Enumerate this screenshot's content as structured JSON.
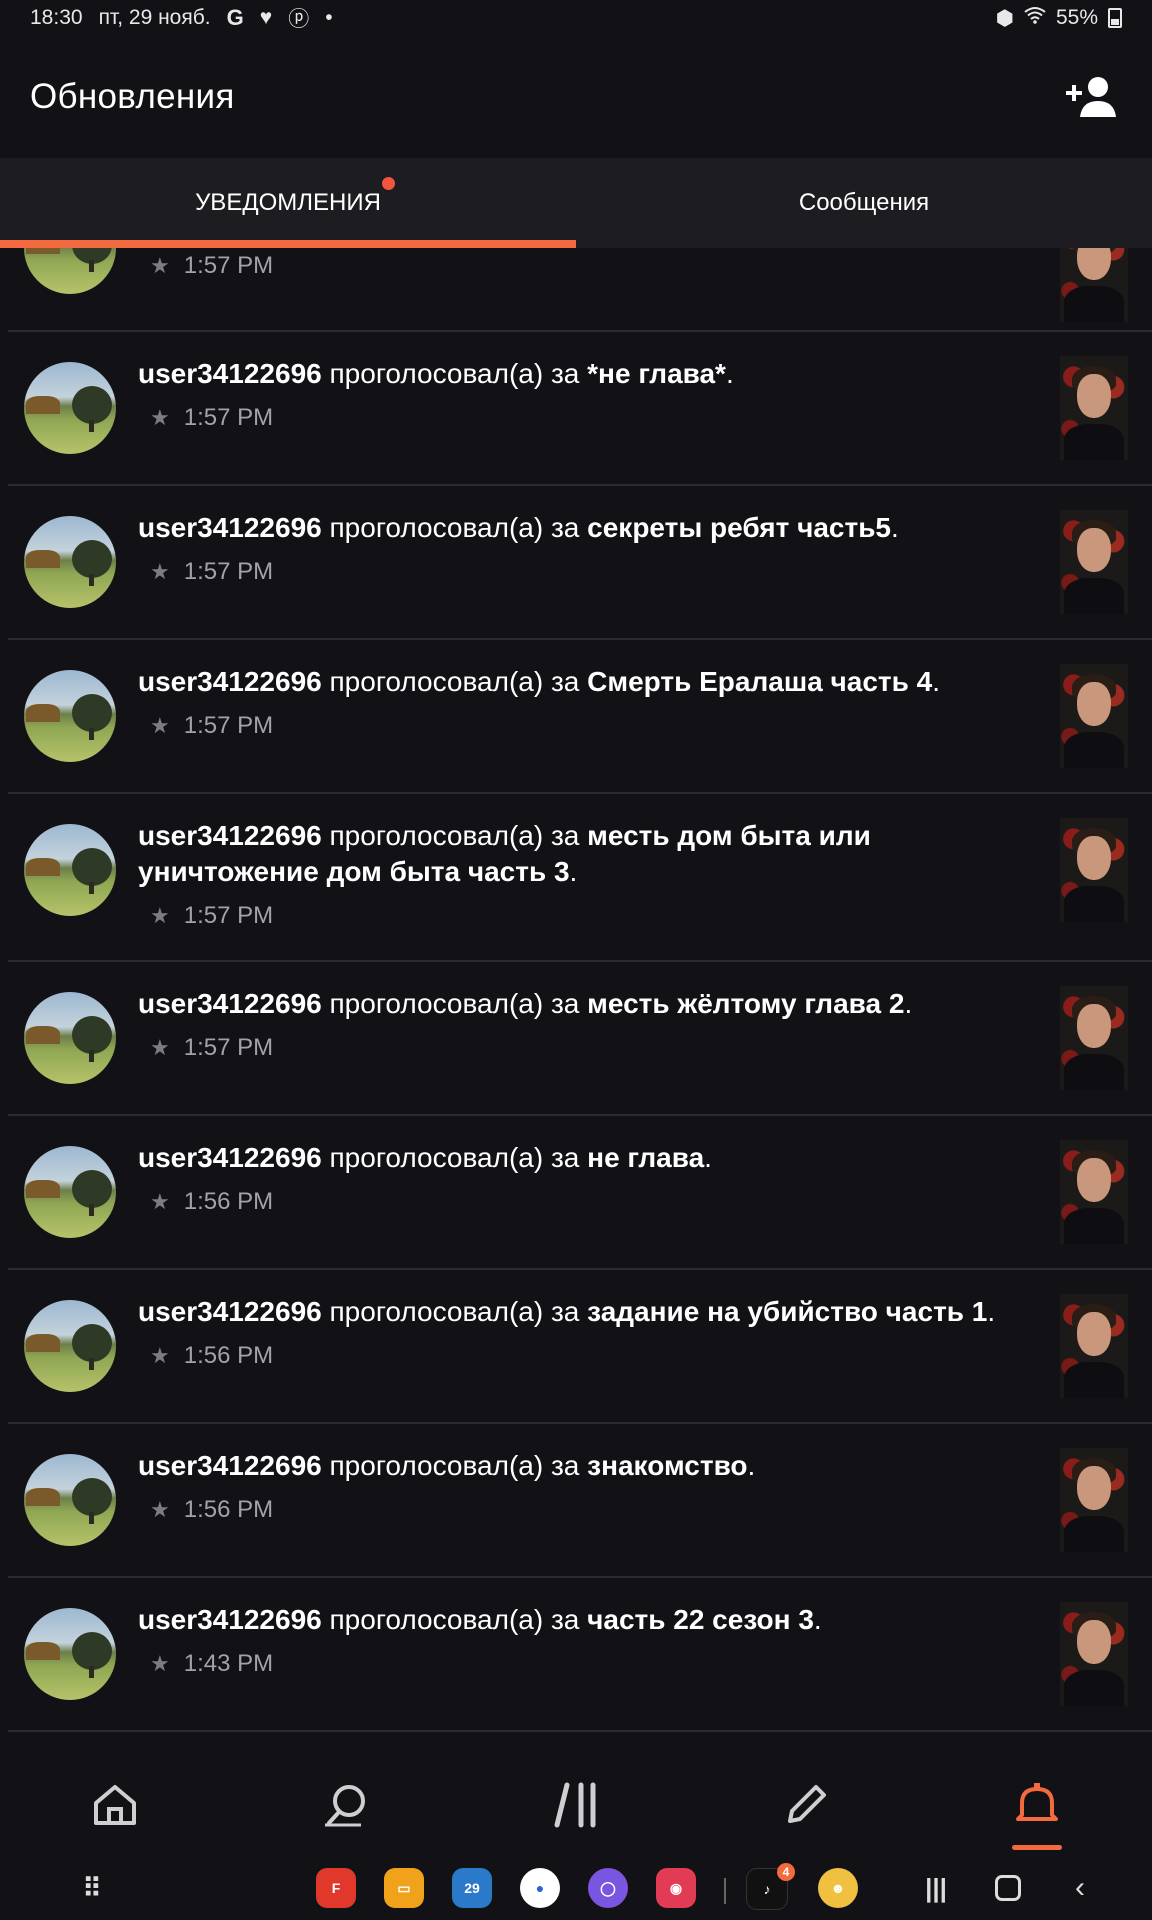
{
  "status_bar": {
    "time": "18:30",
    "date": "пт, 29 нояб.",
    "battery": "55%",
    "icons": [
      "google-icon",
      "heart-icon",
      "pinterest-icon",
      "dot-icon",
      "lock-icon",
      "wifi-icon",
      "battery-icon"
    ]
  },
  "header": {
    "title": "Обновления",
    "action_icon": "add-user-icon"
  },
  "tabs": [
    {
      "label": "УВЕДОМЛЕНИЯ",
      "active": true,
      "has_dot": true
    },
    {
      "label": "Сообщения",
      "active": false,
      "has_dot": false
    }
  ],
  "notifications": [
    {
      "user": "",
      "verb": "",
      "story": "",
      "suffix": "",
      "time": "1:57 PM"
    },
    {
      "user": "user34122696",
      "verb": " проголосовал(а) за ",
      "story": "*не глава*",
      "suffix": ".",
      "time": "1:57 PM"
    },
    {
      "user": "user34122696",
      "verb": " проголосовал(а) за ",
      "story": "секреты ребят часть5",
      "suffix": ".",
      "time": "1:57 PM"
    },
    {
      "user": "user34122696",
      "verb": " проголосовал(а) за ",
      "story": "Смерть Ералаша часть 4",
      "suffix": ".",
      "time": "1:57 PM"
    },
    {
      "user": "user34122696",
      "verb": " проголосовал(а) за ",
      "story": "месть дом быта или уничтожение дом быта часть 3",
      "suffix": ".",
      "time": "1:57 PM"
    },
    {
      "user": "user34122696",
      "verb": " проголосовал(а) за ",
      "story": "месть жёлтому глава 2",
      "suffix": ".",
      "time": "1:57 PM"
    },
    {
      "user": "user34122696",
      "verb": " проголосовал(а) за ",
      "story": "не глава",
      "suffix": ".",
      "time": "1:56 PM"
    },
    {
      "user": "user34122696",
      "verb": " проголосовал(а) за ",
      "story": "задание на убийство часть 1",
      "suffix": ".",
      "time": "1:56 PM"
    },
    {
      "user": "user34122696",
      "verb": " проголосовал(а) за ",
      "story": "знакомство",
      "suffix": ".",
      "time": "1:56 PM"
    },
    {
      "user": "user34122696",
      "verb": " проголосовал(а) за ",
      "story": "часть 22 сезон 3",
      "suffix": ".",
      "time": "1:43 PM"
    }
  ],
  "bottom_nav": [
    {
      "icon": "home-icon",
      "active": false
    },
    {
      "icon": "search-icon",
      "active": false
    },
    {
      "icon": "library-icon",
      "active": false
    },
    {
      "icon": "write-icon",
      "active": false
    },
    {
      "icon": "bell-icon",
      "active": true
    }
  ],
  "system_bar": {
    "dock_apps": [
      "app-drawer-icon",
      "flipboard-icon",
      "files-icon",
      "calendar-icon",
      "messages-icon",
      "internet-icon",
      "camera-icon",
      "tiktok-icon",
      "game-icon"
    ],
    "calendar_day": "29",
    "tiktok_badge": "4",
    "accent": "#f26a3d"
  }
}
